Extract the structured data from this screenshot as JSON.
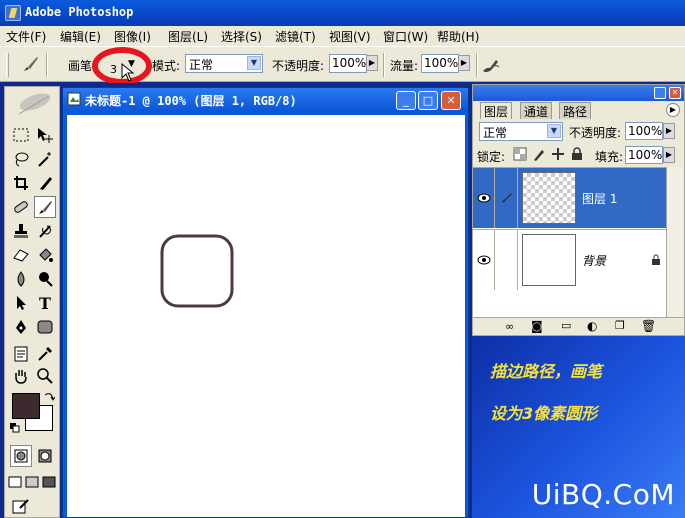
{
  "app": {
    "title": "Adobe Photoshop"
  },
  "menu": [
    "文件(F)",
    "编辑(E)",
    "图像(I)",
    "图层(L)",
    "选择(S)",
    "滤镜(T)",
    "视图(V)",
    "窗口(W)",
    "帮助(H)"
  ],
  "options": {
    "brush_label": "画笔",
    "brush_size": "3",
    "mode_label": "模式:",
    "mode_value": "正常",
    "opacity_label": "不透明度:",
    "opacity_value": "100%",
    "flow_label": "流量:",
    "flow_value": "100%"
  },
  "document": {
    "title": "未标题-1 @ 100% (图层 1, RGB/8)",
    "shape_color": "#4b3a3e"
  },
  "layers_panel": {
    "tabs": [
      "图层",
      "通道",
      "路径"
    ],
    "blend_mode": "正常",
    "opacity_label": "不透明度:",
    "opacity_value": "100%",
    "lock_label": "锁定:",
    "fill_label": "填充:",
    "fill_value": "100%",
    "layers": [
      {
        "name": "图层 1",
        "selected": true
      },
      {
        "name": "背景",
        "locked": true
      }
    ]
  },
  "caption": {
    "line1": "描边路径，画笔",
    "line2": "设为3像素圆形"
  },
  "watermark": "UiBQ.CoM",
  "colors": {
    "foreground": "#3d2a2f",
    "background": "#ffffff",
    "highlight": "#e8161c",
    "selection": "#316ac5"
  }
}
